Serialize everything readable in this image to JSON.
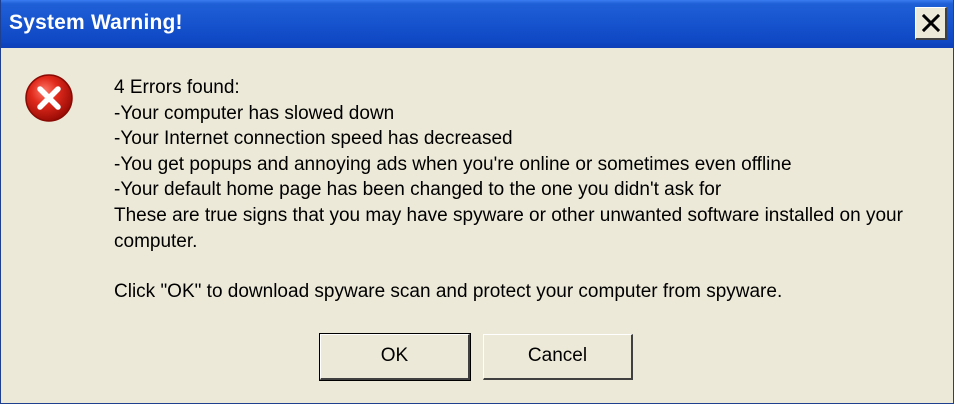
{
  "window": {
    "title": "System Warning!",
    "close_symbol": "×"
  },
  "icon": {
    "name": "error-icon",
    "color": "#d42020"
  },
  "message": {
    "lines": [
      "4 Errors found:",
      "-Your computer has slowed down",
      "-Your Internet connection speed has decreased",
      "-You get popups and annoying ads when you're online or sometimes even offline",
      "-Your default home page has been changed to the one you didn't ask for"
    ],
    "summary": "These are true signs that you may have spyware or other unwanted software installed on your computer.",
    "instruction": "Click \"OK\" to download spyware scan and protect your computer from spyware."
  },
  "buttons": {
    "ok": "OK",
    "cancel": "Cancel"
  },
  "colors": {
    "titlebar": "#1856d0",
    "dialog_bg": "#ece9d8"
  }
}
